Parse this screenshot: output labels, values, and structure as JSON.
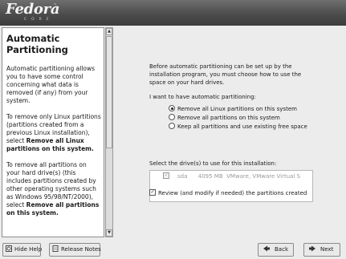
{
  "header": {
    "logo": "Fedora",
    "logo_sub": "CORE",
    "logo_tm": "™"
  },
  "help": {
    "title": "Automatic Partitioning",
    "para1": "Automatic partitioning allows you to have some control concerning what data is removed (if any) from your system.",
    "para2_pre": "To remove only Linux partitions (partitions created from a previous Linux installation), select ",
    "para2_bold": "Remove all Linux partitions on this system.",
    "para3_pre": "To remove all partitions on your hard drive(s) (this includes partitions created by other operating systems such as Windows 95/98/NT/2000), select ",
    "para3_bold": "Remove all partitions on this system."
  },
  "main": {
    "intro": "Before automatic partitioning can be set up by the installation program, you must choose how to use the space on your hard drives.",
    "prompt": "I want to have automatic partitioning:",
    "options": [
      {
        "label": "Remove all Linux partitions on this system",
        "selected": true
      },
      {
        "label": "Remove all partitions on this system",
        "selected": false
      },
      {
        "label": "Keep all partitions and use existing free space",
        "selected": false
      }
    ],
    "drive_label": "Select the drive(s) to use for this installation:",
    "drives": [
      {
        "name": "sda",
        "size": "4095 MB",
        "model": "VMware, VMware Virtual S",
        "checked": true
      }
    ],
    "review_label": "Review (and modify if needed) the partitions created",
    "review_checked": true
  },
  "buttons": {
    "hide_help": "Hide Help",
    "release_notes": "Release Notes",
    "back": "Back",
    "next": "Next"
  }
}
